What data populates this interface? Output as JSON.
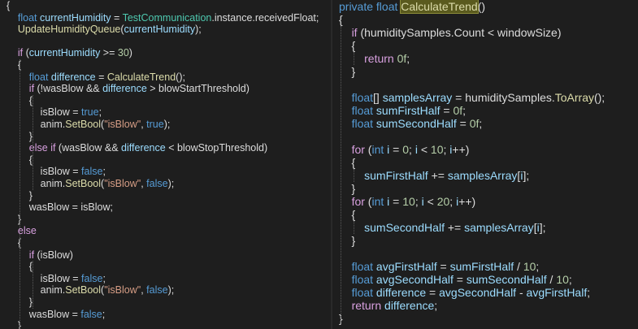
{
  "left_pane": {
    "lines": [
      [
        {
          "t": "{",
          "c": "plain"
        }
      ],
      [
        {
          "t": "    ",
          "c": "plain"
        },
        {
          "t": "float",
          "c": "kw"
        },
        {
          "t": " ",
          "c": "plain"
        },
        {
          "t": "currentHumidity",
          "c": "var"
        },
        {
          "t": " = ",
          "c": "plain"
        },
        {
          "t": "TestCommunication",
          "c": "type"
        },
        {
          "t": ".instance.receivedFloat;",
          "c": "plain"
        }
      ],
      [
        {
          "t": "    ",
          "c": "plain"
        },
        {
          "t": "UpdateHumidityQueue",
          "c": "method"
        },
        {
          "t": "(",
          "c": "plain"
        },
        {
          "t": "currentHumidity",
          "c": "var"
        },
        {
          "t": ");",
          "c": "plain"
        }
      ],
      [],
      [
        {
          "t": "    ",
          "c": "plain"
        },
        {
          "t": "if",
          "c": "kwc"
        },
        {
          "t": " (",
          "c": "plain"
        },
        {
          "t": "currentHumidity",
          "c": "var"
        },
        {
          "t": " >= ",
          "c": "plain"
        },
        {
          "t": "30",
          "c": "num"
        },
        {
          "t": ")",
          "c": "plain"
        }
      ],
      [
        {
          "t": "    {",
          "c": "plain"
        }
      ],
      [
        {
          "t": "        ",
          "c": "plain"
        },
        {
          "t": "float",
          "c": "kw"
        },
        {
          "t": " ",
          "c": "plain"
        },
        {
          "t": "difference",
          "c": "var"
        },
        {
          "t": " = ",
          "c": "plain"
        },
        {
          "t": "CalculateTrend",
          "c": "method"
        },
        {
          "t": "();",
          "c": "plain"
        }
      ],
      [
        {
          "t": "        ",
          "c": "plain"
        },
        {
          "t": "if",
          "c": "kwc"
        },
        {
          "t": " (!wasBlow && ",
          "c": "plain"
        },
        {
          "t": "difference",
          "c": "var"
        },
        {
          "t": " > blowStartThreshold)",
          "c": "plain"
        }
      ],
      [
        {
          "t": "        {",
          "c": "plain"
        }
      ],
      [
        {
          "t": "            isBlow = ",
          "c": "plain"
        },
        {
          "t": "true",
          "c": "kw"
        },
        {
          "t": ";",
          "c": "plain"
        }
      ],
      [
        {
          "t": "            anim.",
          "c": "plain"
        },
        {
          "t": "SetBool",
          "c": "method"
        },
        {
          "t": "(",
          "c": "plain"
        },
        {
          "t": "\"isBlow\"",
          "c": "str"
        },
        {
          "t": ", ",
          "c": "plain"
        },
        {
          "t": "true",
          "c": "kw"
        },
        {
          "t": ");",
          "c": "plain"
        }
      ],
      [
        {
          "t": "        }",
          "c": "plain"
        }
      ],
      [
        {
          "t": "        ",
          "c": "plain"
        },
        {
          "t": "else if",
          "c": "kwc"
        },
        {
          "t": " (wasBlow && ",
          "c": "plain"
        },
        {
          "t": "difference",
          "c": "var"
        },
        {
          "t": " < blowStopThreshold)",
          "c": "plain"
        }
      ],
      [
        {
          "t": "        {",
          "c": "plain"
        }
      ],
      [
        {
          "t": "            isBlow = ",
          "c": "plain"
        },
        {
          "t": "false",
          "c": "kw"
        },
        {
          "t": ";",
          "c": "plain"
        }
      ],
      [
        {
          "t": "            anim.",
          "c": "plain"
        },
        {
          "t": "SetBool",
          "c": "method"
        },
        {
          "t": "(",
          "c": "plain"
        },
        {
          "t": "\"isBlow\"",
          "c": "str"
        },
        {
          "t": ", ",
          "c": "plain"
        },
        {
          "t": "false",
          "c": "kw"
        },
        {
          "t": ");",
          "c": "plain"
        }
      ],
      [
        {
          "t": "        }",
          "c": "plain"
        }
      ],
      [
        {
          "t": "        wasBlow = isBlow;",
          "c": "plain"
        }
      ],
      [
        {
          "t": "    }",
          "c": "plain"
        }
      ],
      [
        {
          "t": "    ",
          "c": "plain"
        },
        {
          "t": "else",
          "c": "kwc"
        }
      ],
      [
        {
          "t": "    {",
          "c": "plain"
        }
      ],
      [
        {
          "t": "        ",
          "c": "plain"
        },
        {
          "t": "if",
          "c": "kwc"
        },
        {
          "t": " (isBlow)",
          "c": "plain"
        }
      ],
      [
        {
          "t": "        {",
          "c": "plain"
        }
      ],
      [
        {
          "t": "            isBlow = ",
          "c": "plain"
        },
        {
          "t": "false",
          "c": "kw"
        },
        {
          "t": ";",
          "c": "plain"
        }
      ],
      [
        {
          "t": "            anim.",
          "c": "plain"
        },
        {
          "t": "SetBool",
          "c": "method"
        },
        {
          "t": "(",
          "c": "plain"
        },
        {
          "t": "\"isBlow\"",
          "c": "str"
        },
        {
          "t": ", ",
          "c": "plain"
        },
        {
          "t": "false",
          "c": "kw"
        },
        {
          "t": ");",
          "c": "plain"
        }
      ],
      [
        {
          "t": "        }",
          "c": "plain"
        }
      ],
      [
        {
          "t": "        wasBlow = ",
          "c": "plain"
        },
        {
          "t": "false",
          "c": "kw"
        },
        {
          "t": ";",
          "c": "plain"
        }
      ],
      [
        {
          "t": "    }",
          "c": "plain"
        }
      ]
    ]
  },
  "right_pane": {
    "lines": [
      [
        {
          "t": "private",
          "c": "kw"
        },
        {
          "t": " ",
          "c": "plain"
        },
        {
          "t": "float",
          "c": "kw"
        },
        {
          "t": " ",
          "c": "plain"
        },
        {
          "t": "CalculateTrend",
          "c": "method",
          "hl": true
        },
        {
          "t": "()",
          "c": "plain"
        }
      ],
      [
        {
          "t": "{",
          "c": "plain"
        }
      ],
      [
        {
          "t": "    ",
          "c": "plain"
        },
        {
          "t": "if",
          "c": "kwc"
        },
        {
          "t": " (humiditySamples.Count < windowSize)",
          "c": "plain"
        }
      ],
      [
        {
          "t": "    {",
          "c": "plain"
        }
      ],
      [
        {
          "t": "        ",
          "c": "plain"
        },
        {
          "t": "return",
          "c": "kwc"
        },
        {
          "t": " ",
          "c": "plain"
        },
        {
          "t": "0f",
          "c": "num"
        },
        {
          "t": ";",
          "c": "plain"
        }
      ],
      [
        {
          "t": "    }",
          "c": "plain"
        }
      ],
      [],
      [
        {
          "t": "    ",
          "c": "plain"
        },
        {
          "t": "float",
          "c": "kw"
        },
        {
          "t": "[] ",
          "c": "plain"
        },
        {
          "t": "samplesArray",
          "c": "var"
        },
        {
          "t": " = humiditySamples.",
          "c": "plain"
        },
        {
          "t": "ToArray",
          "c": "method"
        },
        {
          "t": "();",
          "c": "plain"
        }
      ],
      [
        {
          "t": "    ",
          "c": "plain"
        },
        {
          "t": "float",
          "c": "kw"
        },
        {
          "t": " ",
          "c": "plain"
        },
        {
          "t": "sumFirstHalf",
          "c": "var"
        },
        {
          "t": " = ",
          "c": "plain"
        },
        {
          "t": "0f",
          "c": "num"
        },
        {
          "t": ";",
          "c": "plain"
        }
      ],
      [
        {
          "t": "    ",
          "c": "plain"
        },
        {
          "t": "float",
          "c": "kw"
        },
        {
          "t": " ",
          "c": "plain"
        },
        {
          "t": "sumSecondHalf",
          "c": "var"
        },
        {
          "t": " = ",
          "c": "plain"
        },
        {
          "t": "0f",
          "c": "num"
        },
        {
          "t": ";",
          "c": "plain"
        }
      ],
      [],
      [
        {
          "t": "    ",
          "c": "plain"
        },
        {
          "t": "for",
          "c": "kwc"
        },
        {
          "t": " (",
          "c": "plain"
        },
        {
          "t": "int",
          "c": "kw"
        },
        {
          "t": " ",
          "c": "plain"
        },
        {
          "t": "i",
          "c": "var"
        },
        {
          "t": " = ",
          "c": "plain"
        },
        {
          "t": "0",
          "c": "num"
        },
        {
          "t": "; ",
          "c": "plain"
        },
        {
          "t": "i",
          "c": "var"
        },
        {
          "t": " < ",
          "c": "plain"
        },
        {
          "t": "10",
          "c": "num"
        },
        {
          "t": "; ",
          "c": "plain"
        },
        {
          "t": "i",
          "c": "var"
        },
        {
          "t": "++)",
          "c": "plain"
        }
      ],
      [
        {
          "t": "    {",
          "c": "plain"
        }
      ],
      [
        {
          "t": "        ",
          "c": "plain"
        },
        {
          "t": "sumFirstHalf",
          "c": "var"
        },
        {
          "t": " += ",
          "c": "plain"
        },
        {
          "t": "samplesArray",
          "c": "var"
        },
        {
          "t": "[",
          "c": "plain"
        },
        {
          "t": "i",
          "c": "var"
        },
        {
          "t": "];",
          "c": "plain"
        }
      ],
      [
        {
          "t": "    }",
          "c": "plain"
        }
      ],
      [
        {
          "t": "    ",
          "c": "plain"
        },
        {
          "t": "for",
          "c": "kwc"
        },
        {
          "t": " (",
          "c": "plain"
        },
        {
          "t": "int",
          "c": "kw"
        },
        {
          "t": " ",
          "c": "plain"
        },
        {
          "t": "i",
          "c": "var"
        },
        {
          "t": " = ",
          "c": "plain"
        },
        {
          "t": "10",
          "c": "num"
        },
        {
          "t": "; ",
          "c": "plain"
        },
        {
          "t": "i",
          "c": "var"
        },
        {
          "t": " < ",
          "c": "plain"
        },
        {
          "t": "20",
          "c": "num"
        },
        {
          "t": "; ",
          "c": "plain"
        },
        {
          "t": "i",
          "c": "var"
        },
        {
          "t": "++)",
          "c": "plain"
        }
      ],
      [
        {
          "t": "    {",
          "c": "plain"
        }
      ],
      [
        {
          "t": "        ",
          "c": "plain"
        },
        {
          "t": "sumSecondHalf",
          "c": "var"
        },
        {
          "t": " += ",
          "c": "plain"
        },
        {
          "t": "samplesArray",
          "c": "var"
        },
        {
          "t": "[",
          "c": "plain"
        },
        {
          "t": "i",
          "c": "var"
        },
        {
          "t": "];",
          "c": "plain"
        }
      ],
      [
        {
          "t": "    }",
          "c": "plain"
        }
      ],
      [],
      [
        {
          "t": "    ",
          "c": "plain"
        },
        {
          "t": "float",
          "c": "kw"
        },
        {
          "t": " ",
          "c": "plain"
        },
        {
          "t": "avgFirstHalf",
          "c": "var"
        },
        {
          "t": " = ",
          "c": "plain"
        },
        {
          "t": "sumFirstHalf",
          "c": "var"
        },
        {
          "t": " / ",
          "c": "plain"
        },
        {
          "t": "10",
          "c": "num"
        },
        {
          "t": ";",
          "c": "plain"
        }
      ],
      [
        {
          "t": "    ",
          "c": "plain"
        },
        {
          "t": "float",
          "c": "kw"
        },
        {
          "t": " ",
          "c": "plain"
        },
        {
          "t": "avgSecondHalf",
          "c": "var"
        },
        {
          "t": " = ",
          "c": "plain"
        },
        {
          "t": "sumSecondHalf",
          "c": "var"
        },
        {
          "t": " / ",
          "c": "plain"
        },
        {
          "t": "10",
          "c": "num"
        },
        {
          "t": ";",
          "c": "plain"
        }
      ],
      [
        {
          "t": "    ",
          "c": "plain"
        },
        {
          "t": "float",
          "c": "kw"
        },
        {
          "t": " ",
          "c": "plain"
        },
        {
          "t": "difference",
          "c": "var"
        },
        {
          "t": " = ",
          "c": "plain"
        },
        {
          "t": "avgSecondHalf",
          "c": "var"
        },
        {
          "t": " - ",
          "c": "plain"
        },
        {
          "t": "avgFirstHalf",
          "c": "var"
        },
        {
          "t": ";",
          "c": "plain"
        }
      ],
      [
        {
          "t": "    ",
          "c": "plain"
        },
        {
          "t": "return",
          "c": "kwc"
        },
        {
          "t": " ",
          "c": "plain"
        },
        {
          "t": "difference",
          "c": "var"
        },
        {
          "t": ";",
          "c": "plain"
        }
      ],
      [
        {
          "t": "}",
          "c": "plain"
        }
      ]
    ]
  },
  "theme": {
    "background": "#1e1e1e",
    "keyword": "#569cd6",
    "control_keyword": "#d8a0df",
    "type": "#4ec9b0",
    "method": "#dcdcaa",
    "variable": "#9cdcfe",
    "string": "#d69d85",
    "number": "#b5cea8",
    "plain": "#dcdcdc",
    "highlight": "#5a5a1e"
  }
}
